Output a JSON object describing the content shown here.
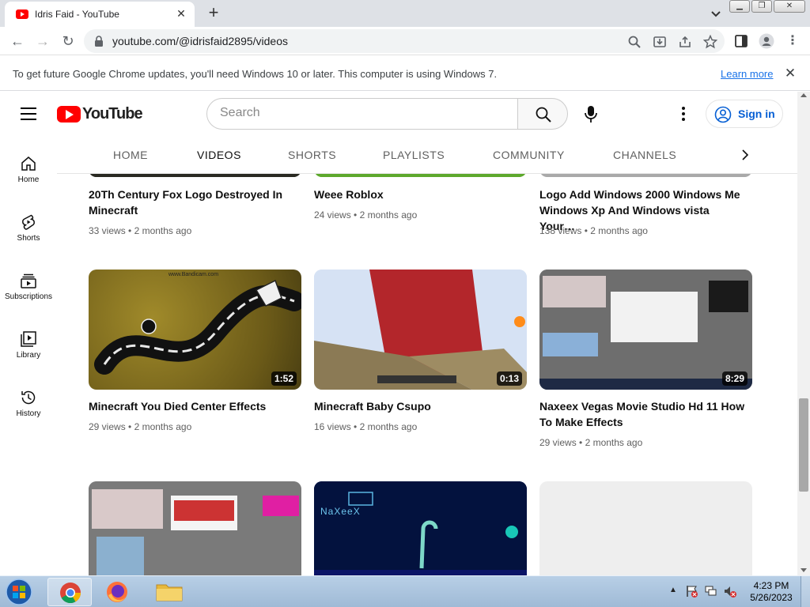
{
  "browser": {
    "tab_title": "Idris Faid - YouTube",
    "url": "youtube.com/@idrisfaid2895/videos"
  },
  "infobar": {
    "message": "To get future Google Chrome updates, you'll need Windows 10 or later. This computer is using Windows 7.",
    "learn_more": "Learn more"
  },
  "youtube": {
    "logo_text": "YouTube",
    "search_placeholder": "Search",
    "sign_in": "Sign in"
  },
  "guide": [
    {
      "label": "Home",
      "icon": "home-icon"
    },
    {
      "label": "Shorts",
      "icon": "shorts-icon"
    },
    {
      "label": "Subscriptions",
      "icon": "subscriptions-icon"
    },
    {
      "label": "Library",
      "icon": "library-icon"
    },
    {
      "label": "History",
      "icon": "history-icon"
    }
  ],
  "channel_tabs": [
    "HOME",
    "VIDEOS",
    "SHORTS",
    "PLAYLISTS",
    "COMMUNITY",
    "CHANNELS"
  ],
  "videos": [
    {
      "title": "20Th Century Fox Logo Destroyed In Minecraft",
      "views": "33 views",
      "age": "2 months ago",
      "duration": ""
    },
    {
      "title": "Weee Roblox",
      "views": "24 views",
      "age": "2 months ago",
      "duration": ""
    },
    {
      "title": "Logo Add Windows 2000 Windows Me Windows Xp And Windows vista Your…",
      "views": "138 views",
      "age": "2 months ago",
      "duration": ""
    },
    {
      "title": "Minecraft You Died Center Effects",
      "views": "29 views",
      "age": "2 months ago",
      "duration": "1:52"
    },
    {
      "title": "Minecraft Baby Csupo",
      "views": "16 views",
      "age": "2 months ago",
      "duration": "0:13"
    },
    {
      "title": "Naxeex Vegas Movie Studio Hd 11 How To Make Effects",
      "views": "29 views",
      "age": "2 months ago",
      "duration": "8:29"
    }
  ],
  "thumb_text": {
    "bandicam": "www.Bandicam.com",
    "naxeex": "NaXeeX"
  },
  "taskbar": {
    "time": "4:23 PM",
    "date": "5/26/2023"
  },
  "colors": {
    "youtube_red": "#ff0000",
    "link_blue": "#065fd4",
    "taskbar": "#a9c3de"
  }
}
